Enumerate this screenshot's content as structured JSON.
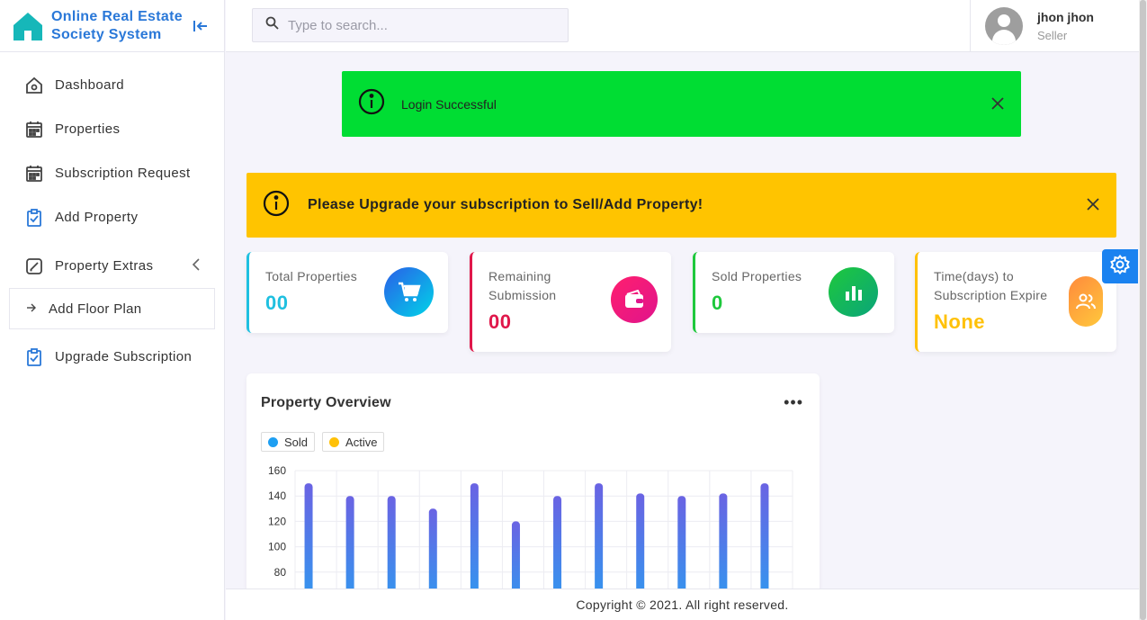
{
  "brand": {
    "title_line1": "Online Real Estate",
    "title_line2": "Society System"
  },
  "sidebar": {
    "items": [
      {
        "label": "Dashboard",
        "icon": "home-icon"
      },
      {
        "label": "Properties",
        "icon": "calendar-icon"
      },
      {
        "label": "Subscription Request",
        "icon": "calendar-icon"
      },
      {
        "label": "Add Property",
        "icon": "clipboard-check-icon"
      },
      {
        "label": "Property Extras",
        "icon": "edit-icon"
      },
      {
        "label": "Upgrade Subscription",
        "icon": "clipboard-check-icon"
      }
    ],
    "subitems": [
      {
        "label": "Add Floor Plan",
        "icon": "arrow-right-icon"
      }
    ]
  },
  "header": {
    "search_placeholder": "Type to search...",
    "user_name": "jhon jhon",
    "user_role": "Seller"
  },
  "alerts": {
    "success": "Login Successful",
    "warning": "Please Upgrade your subscription to Sell/Add Property!"
  },
  "stats": [
    {
      "title": "Total Properties",
      "value": "00",
      "color": "#1fc0e0",
      "icon": "cart-icon"
    },
    {
      "title": "Remaining Submission",
      "value": "00",
      "color": "#e0174a",
      "icon": "wallet-icon"
    },
    {
      "title": "Sold Properties",
      "value": "0",
      "color": "#1ec83c",
      "icon": "bar-chart-icon"
    },
    {
      "title": "Time(days) to Subscription Expire",
      "value": "None",
      "color": "#ffc107",
      "icon": "users-icon"
    }
  ],
  "panel": {
    "title": "Property Overview"
  },
  "chart_data": {
    "type": "bar",
    "title": "Property Overview",
    "series": [
      {
        "name": "Sold",
        "color": "#1e9ff2",
        "values": [
          150,
          140,
          140,
          130,
          150,
          120,
          140,
          150,
          142,
          140,
          142,
          150
        ]
      },
      {
        "name": "Active",
        "color": "#ffc107",
        "values": []
      }
    ],
    "yticks": [
      "160",
      "140",
      "120",
      "100",
      "80"
    ],
    "ylim": [
      60,
      160
    ],
    "grid": true,
    "legend": "top-left"
  },
  "footer": {
    "text": "Copyright © 2021. All right reserved."
  }
}
